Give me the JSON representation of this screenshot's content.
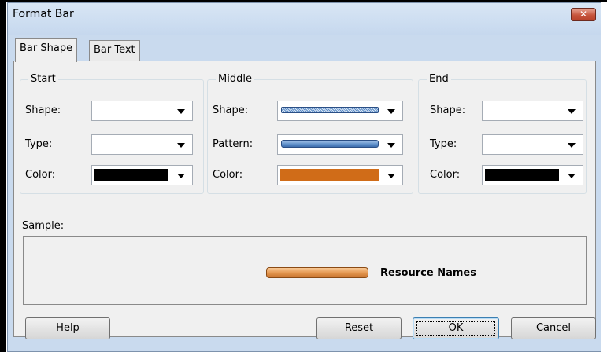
{
  "window": {
    "title": "Format Bar",
    "close_glyph": "✕"
  },
  "tabs": [
    {
      "label": "Bar Shape",
      "active": true
    },
    {
      "label": "Bar Text",
      "active": false
    }
  ],
  "groups": {
    "start": {
      "title": "Start",
      "shape_label": "Shape:",
      "type_label": "Type:",
      "color_label": "Color:",
      "color_value": "#000000"
    },
    "middle": {
      "title": "Middle",
      "shape_label": "Shape:",
      "pattern_label": "Pattern:",
      "color_label": "Color:",
      "color_value": "#d06c18"
    },
    "end": {
      "title": "End",
      "shape_label": "Shape:",
      "type_label": "Type:",
      "color_label": "Color:",
      "color_value": "#000000"
    }
  },
  "sample": {
    "label": "Sample:",
    "bar_text": "Resource Names"
  },
  "buttons": {
    "help": "Help",
    "reset": "Reset",
    "ok": "OK",
    "cancel": "Cancel"
  },
  "icons": {
    "dropdown": "chevron-down-icon",
    "close": "close-icon"
  },
  "colors": {
    "dialog_bg": "#f0f0f0",
    "title_bg": "#c9daee",
    "bar_orange": "#e3954e",
    "bar_blue": "#5a8cc8"
  }
}
